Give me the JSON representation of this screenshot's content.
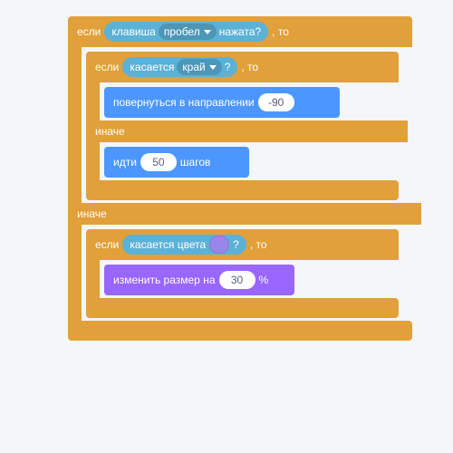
{
  "kw": {
    "if": "если",
    "then": ", то",
    "else": "иначе"
  },
  "sensing": {
    "key_pressed_pre": "клавиша",
    "key_pressed_post": "нажата?",
    "key_name": "пробел",
    "touching_pre": "касается",
    "touching_post": "?",
    "touching_what": "край",
    "touching_color_pre": "касается цвета",
    "touching_color_post": "?"
  },
  "motion": {
    "point_in_direction": "повернуться в направлении",
    "point_value": "-90",
    "move_pre": "идти",
    "move_post": "шагов",
    "move_value": "50"
  },
  "looks": {
    "change_size_pre": "изменить размер на",
    "change_size_post": "%",
    "change_size_value": "30"
  },
  "colors": {
    "control": "#e1a03a",
    "motion": "#4c97ff",
    "sensing": "#5CB1D6",
    "looks": "#9966ff",
    "color_slot": "#9a86e9"
  }
}
